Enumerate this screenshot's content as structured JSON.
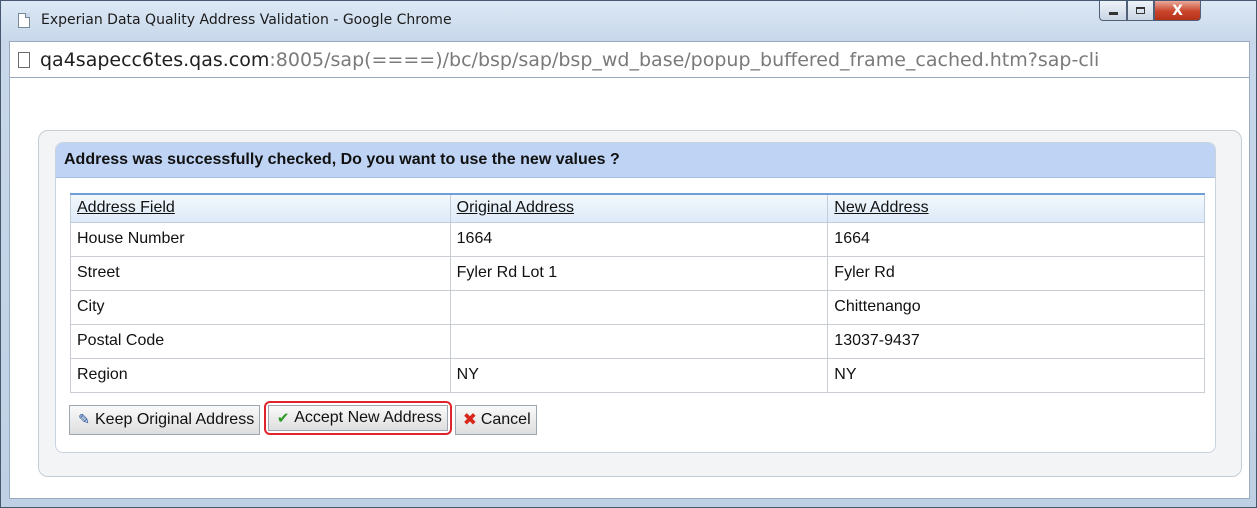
{
  "window": {
    "title": "Experian Data Quality Address Validation - Google Chrome",
    "controls": {
      "minimize": "minimize",
      "maximize": "maximize",
      "close": "X"
    }
  },
  "addressbar": {
    "host": "qa4sapecc6tes.qas.com",
    "path": ":8005/sap(====)/bc/bsp/sap/bsp_wd_base/popup_buffered_frame_cached.htm?sap-cli"
  },
  "dialog": {
    "header": "Address was successfully checked, Do you want to use the new values ?",
    "columns": [
      "Address Field",
      "Original Address",
      "New Address"
    ],
    "rows": [
      {
        "field": "House Number",
        "original": "1664",
        "new": "1664"
      },
      {
        "field": "Street",
        "original": "Fyler Rd Lot 1",
        "new": "Fyler Rd"
      },
      {
        "field": "City",
        "original": "",
        "new": "Chittenango"
      },
      {
        "field": "Postal Code",
        "original": "",
        "new": "13037-9437"
      },
      {
        "field": "Region",
        "original": "NY",
        "new": "NY"
      }
    ],
    "buttons": {
      "keep": "Keep Original Address",
      "accept": "Accept New Address",
      "cancel": "Cancel"
    }
  },
  "icons": {
    "page": "page-icon",
    "keep": "edit-arrow-icon",
    "accept": "checkmark-icon",
    "cancel": "red-x-icon"
  },
  "colors": {
    "header_bg": "#bfd4f4",
    "highlight_border": "#e0242c",
    "accept_icon": "#2a9a22",
    "cancel_icon": "#d8261a"
  }
}
